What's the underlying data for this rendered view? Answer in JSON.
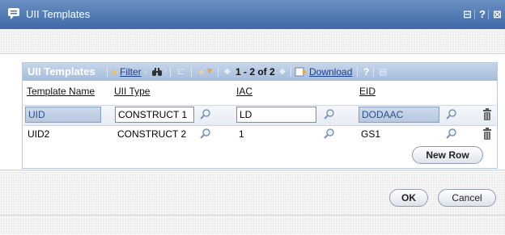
{
  "window": {
    "title": "UII Templates",
    "controls": [
      "⊟",
      "?",
      "⊠"
    ]
  },
  "panel": {
    "title": "UII Templates",
    "filter_label": "Filter",
    "pager": "1 - 2 of 2",
    "download_label": "Download",
    "help": "?"
  },
  "table": {
    "headers": [
      "Template Name",
      "UII Type",
      "IAC",
      "EID"
    ],
    "rows": [
      {
        "template_name": "UID",
        "uii_type": "CONSTRUCT 1",
        "iac": "LD",
        "eid": "DODAAC",
        "editing": true
      },
      {
        "template_name": "UID2",
        "uii_type": "CONSTRUCT 2",
        "iac": "1",
        "eid": "GS1",
        "editing": false
      }
    ]
  },
  "buttons": {
    "new_row": "New Row",
    "ok": "OK",
    "cancel": "Cancel"
  },
  "colors": {
    "titlebar": "#4a74b0",
    "panel_toolbar": "#b3c6e1",
    "link": "#1a3e8c",
    "readonly_cell": "#c2d1e6"
  },
  "icons": [
    "comment-icon",
    "binoculars-icon",
    "column-icon",
    "arrow-up-down-icon",
    "prev-icon",
    "next-icon",
    "download-icon",
    "magnifier-icon",
    "trash-icon"
  ]
}
